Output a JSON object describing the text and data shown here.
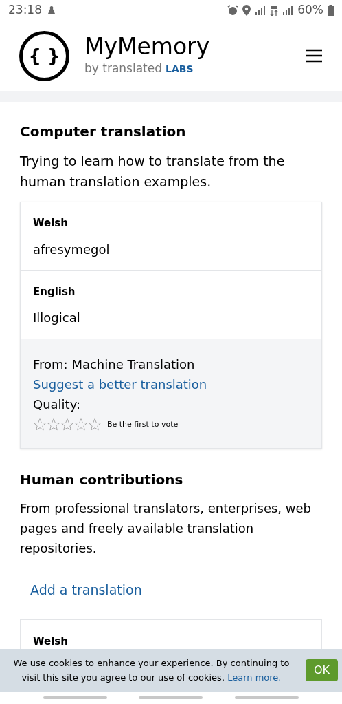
{
  "status_bar": {
    "time": "23:18",
    "battery": "60%"
  },
  "header": {
    "logo_mark": "{ }",
    "title": "MyMemory",
    "subtitle": "by translated",
    "subtitle_brand": "LABS"
  },
  "computer_translation": {
    "heading": "Computer translation",
    "description": "Trying to learn how to translate from the human translation examples.",
    "card": {
      "entries": [
        {
          "language": "Welsh",
          "text": "afresymegol"
        },
        {
          "language": "English",
          "text": "Illogical"
        }
      ],
      "source": "From: Machine Translation",
      "suggest_link": "Suggest a better translation",
      "quality_label": "Quality:",
      "stars": 0,
      "vote_note": "Be the first to vote"
    }
  },
  "human_contributions": {
    "heading": "Human contributions",
    "description": "From professional translators, enterprises, web pages and freely available translation repositories.",
    "add_link": "Add a translation",
    "card": {
      "entries": [
        {
          "language": "Welsh"
        }
      ]
    }
  },
  "cookie_banner": {
    "text": "We use cookies to enhance your experience. By continuing to visit this site you agree to our use of cookies.",
    "link": "Learn more.",
    "button": "OK"
  }
}
